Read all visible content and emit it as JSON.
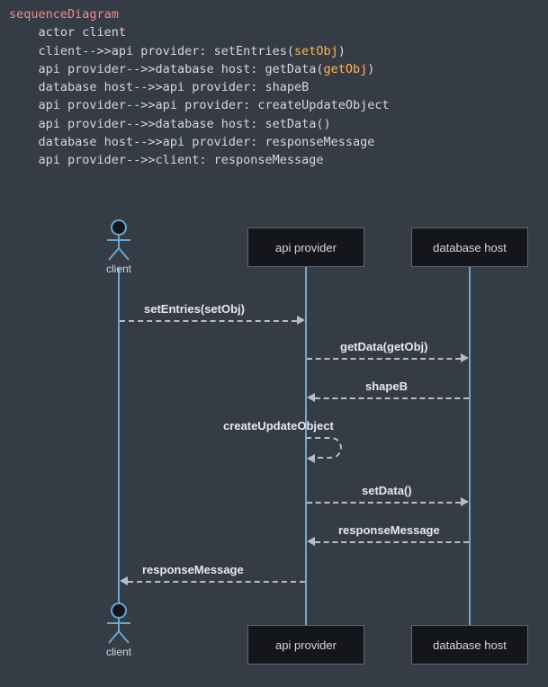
{
  "code": {
    "keyword": "sequenceDiagram",
    "lines": [
      {
        "indent": "    ",
        "prefix": "actor client",
        "call": ""
      },
      {
        "indent": "    ",
        "prefix": "client-->>api provider: setEntries(",
        "call": "setObj",
        "suffix": ")"
      },
      {
        "indent": "    ",
        "prefix": "api provider-->>database host: getData(",
        "call": "getObj",
        "suffix": ")"
      },
      {
        "indent": "    ",
        "prefix": "database host-->>api provider: shapeB",
        "call": ""
      },
      {
        "indent": "    ",
        "prefix": "api provider-->>api provider: createUpdateObject",
        "call": ""
      },
      {
        "indent": "    ",
        "prefix": "api provider-->>database host: setData()",
        "call": ""
      },
      {
        "indent": "    ",
        "prefix": "database host-->>api provider: responseMessage",
        "call": ""
      },
      {
        "indent": "    ",
        "prefix": "api provider-->>client: responseMessage",
        "call": ""
      }
    ]
  },
  "diagram": {
    "participants": {
      "client": "client",
      "api": "api provider",
      "db": "database host"
    },
    "messages": {
      "m1": "setEntries(setObj)",
      "m2": "getData(getObj)",
      "m3": "shapeB",
      "m4": "createUpdateObject",
      "m5": "setData()",
      "m6": "responseMessage",
      "m7": "responseMessage"
    }
  },
  "chart_data": {
    "type": "sequence",
    "participants": [
      {
        "id": "client",
        "label": "client",
        "kind": "actor"
      },
      {
        "id": "api",
        "label": "api provider",
        "kind": "participant"
      },
      {
        "id": "db",
        "label": "database host",
        "kind": "participant"
      }
    ],
    "messages": [
      {
        "from": "client",
        "to": "api",
        "label": "setEntries(setObj)",
        "style": "dashed-open"
      },
      {
        "from": "api",
        "to": "db",
        "label": "getData(getObj)",
        "style": "dashed-open"
      },
      {
        "from": "db",
        "to": "api",
        "label": "shapeB",
        "style": "dashed-open"
      },
      {
        "from": "api",
        "to": "api",
        "label": "createUpdateObject",
        "style": "dashed-open"
      },
      {
        "from": "api",
        "to": "db",
        "label": "setData()",
        "style": "dashed-open"
      },
      {
        "from": "db",
        "to": "api",
        "label": "responseMessage",
        "style": "dashed-open"
      },
      {
        "from": "api",
        "to": "client",
        "label": "responseMessage",
        "style": "dashed-open"
      }
    ]
  }
}
